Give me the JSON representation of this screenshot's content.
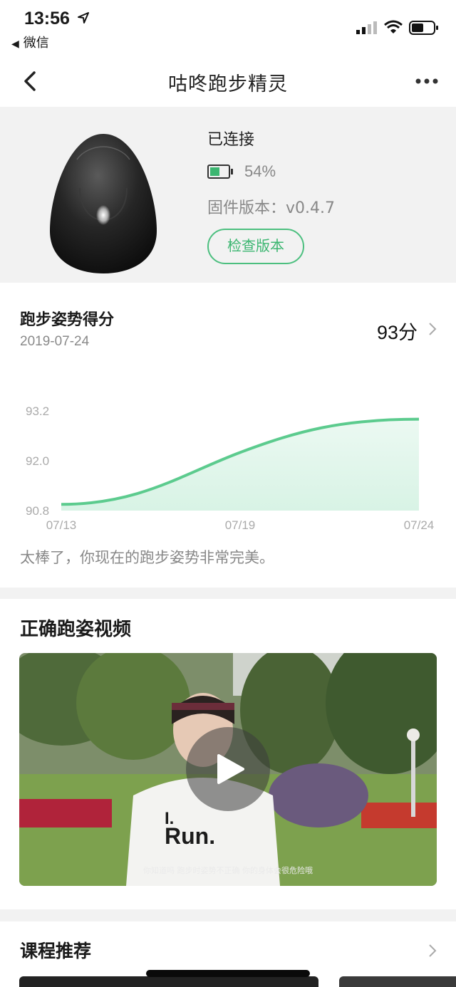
{
  "status_bar": {
    "time": "13:56",
    "back_app_label": "微信",
    "icons": [
      "location-arrow-icon",
      "signal-icon",
      "wifi-icon",
      "battery-icon"
    ]
  },
  "nav": {
    "title": "咕咚跑步精灵",
    "icons": [
      "back-chevron-icon",
      "more-icon"
    ]
  },
  "device": {
    "status": "已连接",
    "battery_level": 0.54,
    "battery_text": "54%",
    "firmware_text": "固件版本：v0.4.7",
    "check_button": "检查版本",
    "accent_color": "#4cbf7f"
  },
  "score": {
    "title": "跑步姿势得分",
    "date": "2019-07-24",
    "value": "93分",
    "comment": "太棒了，你现在的跑步姿势非常完美。"
  },
  "chart_data": {
    "type": "area",
    "x": [
      "07/13",
      "07/19",
      "07/24"
    ],
    "xlabel": "",
    "ylabel": "",
    "y_ticks": [
      "93.2",
      "92.0",
      "90.8"
    ],
    "ylim": [
      90.8,
      93.2
    ],
    "series": [
      {
        "values": [
          90.95,
          92.2,
          93.0
        ]
      }
    ],
    "grid": false,
    "line_color": "#5ccb8e",
    "fill_color": "#d8f3e5"
  },
  "video": {
    "title": "正确跑姿视频",
    "subtitle": "你知道吗 跑步时姿势不正确 你的身体会很危险哦",
    "shirt_text": "I. Run."
  },
  "courses": {
    "title": "课程推荐"
  }
}
